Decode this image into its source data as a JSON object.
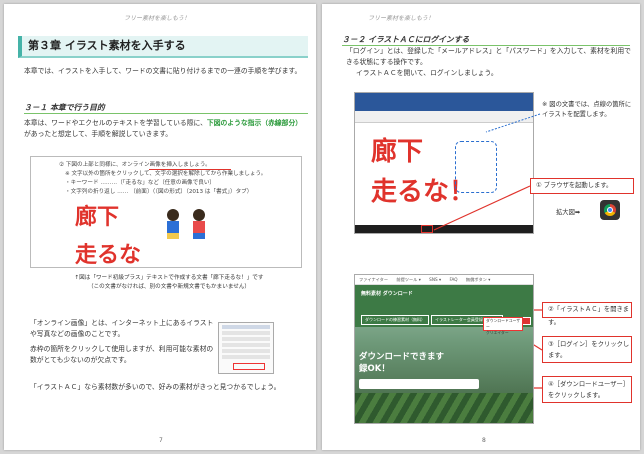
{
  "left_page": {
    "running_head": "フリー素材を楽しもう！",
    "chapter_title": "第３章 イラスト素材を入手する",
    "intro": "本章では、イラストを入手して、ワードの文書に貼り付けるまでの一連の手順を学びます。",
    "section_title": "３－１ 本章で行う目的",
    "section_text_1": "本章は、ワードやエクセルのテキストを学習している際に、",
    "section_text_hl": "下図のような指示（赤線部分）",
    "section_text_2": "があったと想定して、手順を解説していきます。",
    "figure": {
      "line1": "② 下図の上部と同様に、オンライン画像を挿入しましょう。",
      "line2": "※ 文字以外の箇所をクリックして、文字の選択を解除してから作業しましょう。",
      "line3": "・キーワード ………（「走るな」など〔任意の画像で良い〕",
      "line4": "・文字列の折り返し …… 〔前面〕（〔図の形式〕（2013 は「書式」）タブ）",
      "big_text_1": "廊下",
      "big_text_2": "走るな"
    },
    "caption_line1": "↑図は「ワード初級プラス」テキストで作成する文書「廊下走るな！」です",
    "caption_line2": "（この文書がなければ、別の文書や新規文書でもかまいません）",
    "body_1": "「オンライン画像」とは、インターネット上にあるイラストや写真などの画像のことです。",
    "body_2": "赤枠の箇所をクリックして使用しますが、利用可能な素材の数がとても少ないのが欠点です。",
    "body_3": "「イラストＡＣ」なら素材数が多いので、好みの素材がきっと見つかるでしょう。",
    "page_number": "7"
  },
  "right_page": {
    "running_head": "フリー素材を楽しもう！",
    "section_title": "３－２ イラストＡＣにログインする",
    "intro_1": "「ログイン」とは、登録した「メールアドレス」と「パスワード」を入力して、素材を利用できる状態にする操作です。",
    "intro_2": "イラストＡＣを開いて、ログインしましょう。",
    "shot1": {
      "big_text_1": "廊下",
      "big_text_2": "走るな！"
    },
    "note": "※ 図の文書では、点線の箇所にイラストを配置します。",
    "callout_1": "① ブラウザを起動します。",
    "zoom_label": "拡大図➡",
    "shot2": {
      "nav_text": "ファイナイター　　前提ツール ▾　　SNS ▾　　FAQ　　無償ボタン ▾",
      "banner_text": "無料素材 ダウンロード",
      "btn_a": "ダウンロードの練習素材（無料）",
      "btn_b": "イラストレーター会員登録（無料）",
      "login_btn": "ログイン",
      "dl_menu_1": "ダウンロードユーザー",
      "dl_menu_2": "クリエイター",
      "hero_1": "ダウンロードできます",
      "hero_2": "録OK！"
    },
    "callout_2": "②「イラストＡＣ」を開きます。",
    "callout_3": "③［ログイン］をクリックします。",
    "callout_4": "④［ダウンロードユーザー］をクリックします。",
    "page_number": "8"
  },
  "colors": {
    "accent_teal": "#45b3a8",
    "section_green": "#7ac36a",
    "highlight_green": "#2a9a3a",
    "callout_red": "#e0332c",
    "dash_blue": "#2a6fd0"
  }
}
